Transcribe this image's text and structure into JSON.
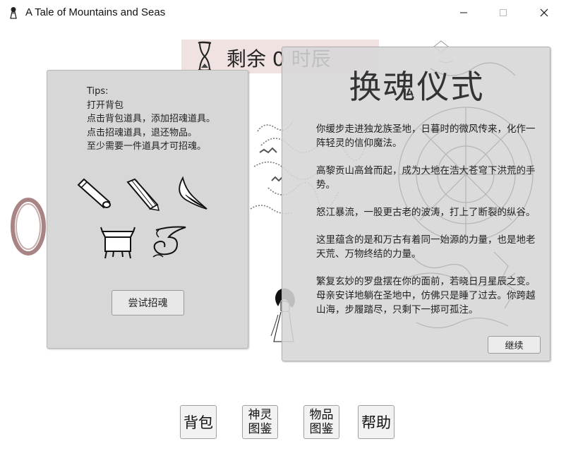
{
  "window": {
    "title": "A Tale of Mountains and Seas"
  },
  "timer": {
    "text": "剩余 0 时辰"
  },
  "tips_panel": {
    "lines": [
      "Tips:",
      "打开背包",
      "点击背包道具，添加招魂道具。",
      "点击招魂道具，退还物品。",
      "至少需要一件道具才可招魂。"
    ],
    "button_label": "尝试招魂",
    "items": [
      "bamboo-scroll",
      "bound-scroll",
      "feather-blade",
      "bronze-cauldron",
      "cloud-swirl"
    ]
  },
  "ritual_panel": {
    "title": "换魂仪式",
    "paragraphs": [
      "你缓步走进独龙族圣地，日暮时的微风传来，化作一阵轻灵的信仰魔法。",
      "高黎贡山高耸而起，成为大地在浩大苍穹下洪荒的手势。",
      "怒江暴流，一股更古老的波涛，打上了断裂的纵谷。",
      "这里蕴含的是和万古有着同一始源的力量，也是地老天荒、万物终结的力量。",
      "繁复玄妙的罗盘摆在你的面前，若晓日月星辰之变。母亲安详地躺在圣地中，仿佛只是睡了过去。你跨越山海，步履踏尽，只剩下一掷可孤注。"
    ],
    "continue_label": "继续"
  },
  "bottom_buttons": {
    "bag": "背包",
    "gods_line1": "神灵",
    "gods_line2": "图鉴",
    "items_line1": "物品",
    "items_line2": "图鉴",
    "help": "帮助"
  },
  "colors": {
    "timer_bg": "#f1e2e2",
    "panel_bg": "#d7d7d7",
    "ring": "#a88484"
  }
}
